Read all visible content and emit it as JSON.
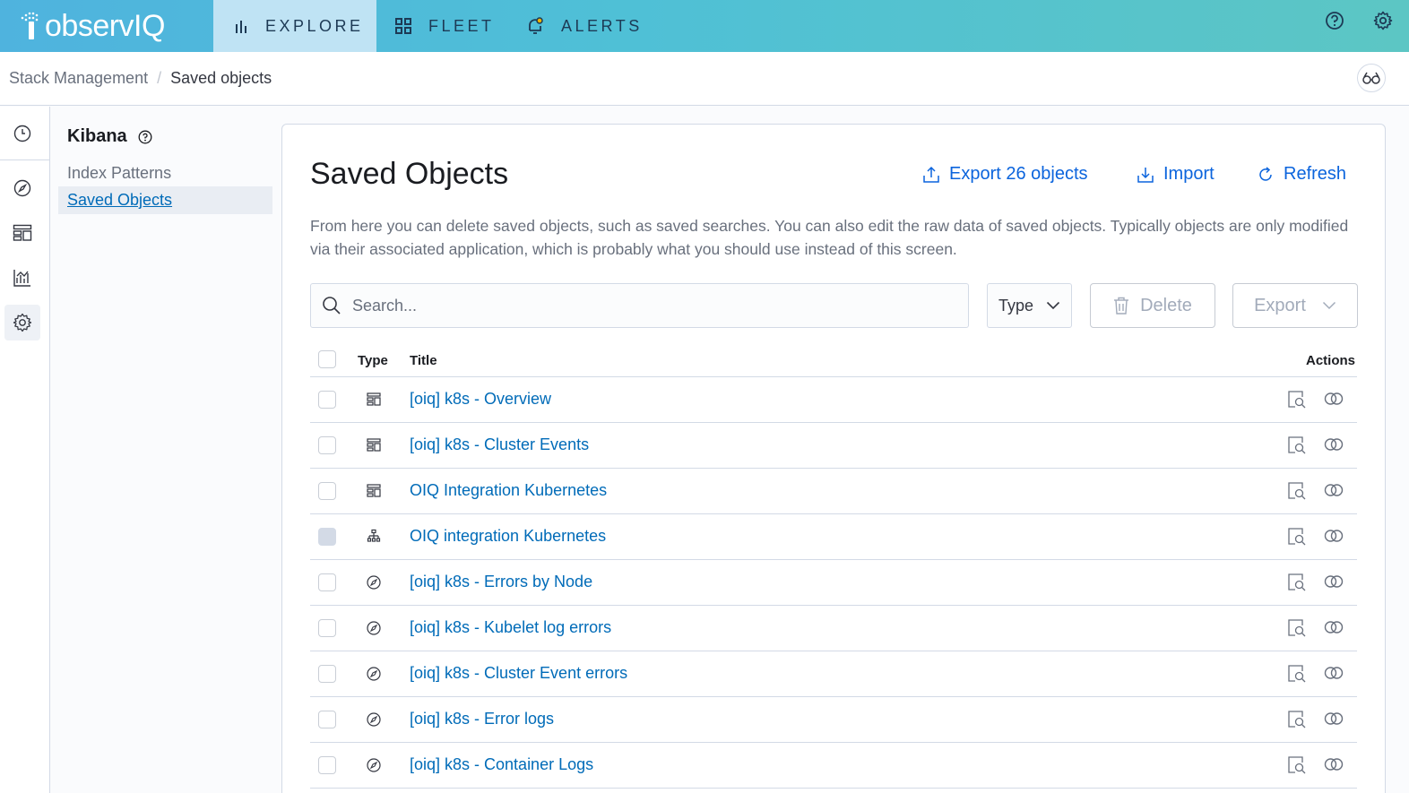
{
  "brand": {
    "logo_text": "observIQ"
  },
  "topnav": {
    "items": [
      {
        "label": "EXPLORE",
        "icon": "bar-chart-icon",
        "active": true
      },
      {
        "label": "FLEET",
        "icon": "grid-icon",
        "active": false
      },
      {
        "label": "ALERTS",
        "icon": "bell-icon",
        "active": false
      }
    ],
    "right_icons": [
      "help-icon",
      "gear-icon"
    ]
  },
  "breadcrumb": {
    "items": [
      "Stack Management",
      "Saved objects"
    ],
    "separator": "/"
  },
  "sidenav": {
    "title": "Kibana",
    "links": [
      {
        "label": "Index Patterns",
        "selected": false
      },
      {
        "label": "Saved Objects",
        "selected": true
      }
    ]
  },
  "rail": {
    "icons": [
      "clock-icon",
      "compass-icon",
      "dashboard-icon",
      "visualize-icon",
      "gear-icon"
    ],
    "active": "gear-icon"
  },
  "main": {
    "title": "Saved Objects",
    "export_all_label": "Export 26 objects",
    "import_label": "Import",
    "refresh_label": "Refresh",
    "description": "From here you can delete saved objects, such as saved searches. You can also edit the raw data of saved objects. Typically objects are only modified via their associated application, which is probably what you should use instead of this screen.",
    "search_placeholder": "Search...",
    "type_filter_label": "Type",
    "delete_label": "Delete",
    "export_label": "Export"
  },
  "table": {
    "headers": {
      "type": "Type",
      "title": "Title",
      "actions": "Actions"
    },
    "rows": [
      {
        "type": "dashboard",
        "title": "[oiq] k8s - Overview",
        "selectable": true
      },
      {
        "type": "dashboard",
        "title": "[oiq] k8s - Cluster Events",
        "selectable": true
      },
      {
        "type": "dashboard",
        "title": "OIQ Integration Kubernetes",
        "selectable": true
      },
      {
        "type": "index-pattern",
        "title": "OIQ integration Kubernetes",
        "selectable": false
      },
      {
        "type": "search",
        "title": "[oiq] k8s - Errors by Node",
        "selectable": true
      },
      {
        "type": "search",
        "title": "[oiq] k8s - Kubelet log errors",
        "selectable": true
      },
      {
        "type": "search",
        "title": "[oiq] k8s - Cluster Event errors",
        "selectable": true
      },
      {
        "type": "search",
        "title": "[oiq] k8s - Error logs",
        "selectable": true
      },
      {
        "type": "search",
        "title": "[oiq] k8s - Container Logs",
        "selectable": true
      }
    ]
  },
  "colors": {
    "link": "#006bb8",
    "primary": "#0b64dd",
    "topbar_start": "#4fb3de",
    "topbar_end": "#5cc6c4",
    "active_nav": "#bfe3f4"
  }
}
